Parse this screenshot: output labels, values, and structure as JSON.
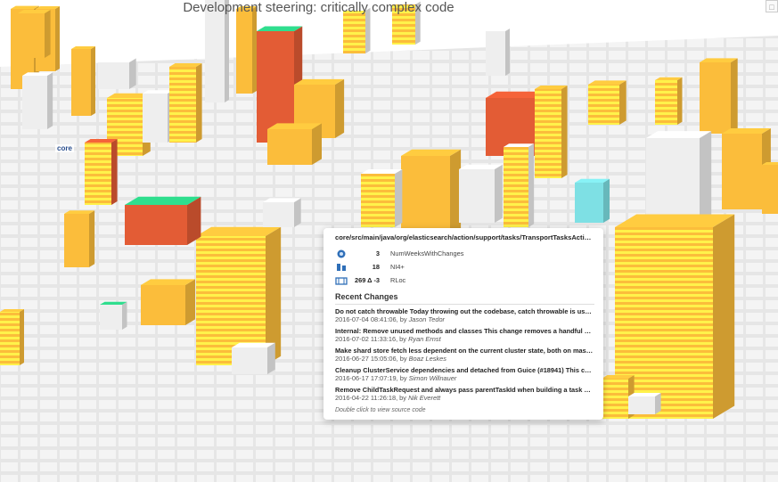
{
  "title": "Development steering: critically complex code",
  "city_label": "core",
  "colors": {
    "street": "#dcdcdc",
    "building_white": "#eeeeee",
    "building_orange": "#fbbd3b",
    "building_red": "#e35c35",
    "building_cyan": "#7ee0e4",
    "stripe_yellow": "#fff24a",
    "green_top": "#2fde8e"
  },
  "tooltip": {
    "path": "core/src/main/java/org/elasticsearch/action/support/tasks/TransportTasksAction.java",
    "metrics": [
      {
        "icon": "fire-icon",
        "value": "3",
        "label": "NumWeeksWithChanges"
      },
      {
        "icon": "bug-icon",
        "value": "18",
        "label": "NI4+"
      },
      {
        "icon": "building-icon",
        "value": "269  Δ -3",
        "label": "RLoc"
      }
    ],
    "recent_changes_label": "Recent Changes",
    "commits": [
      {
        "message": "Do not catch throwable Today throwing out the codebase, catch throwable is used wit…",
        "date": "2016-07-04 08:41:06, by",
        "author": "Jason Tedor"
      },
      {
        "message": "Internal: Remove unused methods and classes This change removes a handful of clas…",
        "date": "2016-07-02 11:33:16, by",
        "author": "Ryan Ernst"
      },
      {
        "message": "Make shard store fetch less dependent on the current cluster state, both on master …",
        "date": "2016-06-27 15:05:06, by",
        "author": "Boaz Leskes"
      },
      {
        "message": "Cleanup ClusterService dependencies and detached from Guice (#18941) This change …",
        "date": "2016-06-17 17:07:19, by",
        "author": "Simon Willnauer"
      },
      {
        "message": "Remove ChildTaskRequest and always pass parentTaskId when building a task Passi…",
        "date": "2016-04-22 11:26:18, by",
        "author": "Nik Everett"
      }
    ],
    "footer": "Double click to view source code"
  }
}
